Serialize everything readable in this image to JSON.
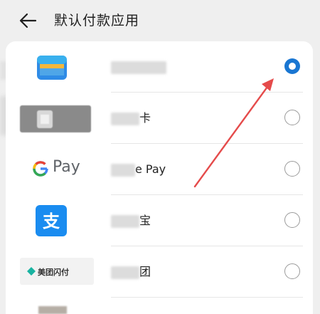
{
  "header": {
    "title": "默认付款应用"
  },
  "rows": [
    {
      "label": "",
      "selected": true
    },
    {
      "label": "卡",
      "selected": false
    },
    {
      "label": "e Pay",
      "selected": false,
      "logo_text": "Pay"
    },
    {
      "label": "宝",
      "selected": false
    },
    {
      "label": "团",
      "selected": false,
      "logo_text": "美团闪付"
    }
  ],
  "colors": {
    "accent": "#1976d2",
    "arrow": "#e54b4b",
    "alipay": "#1a8cf0"
  }
}
